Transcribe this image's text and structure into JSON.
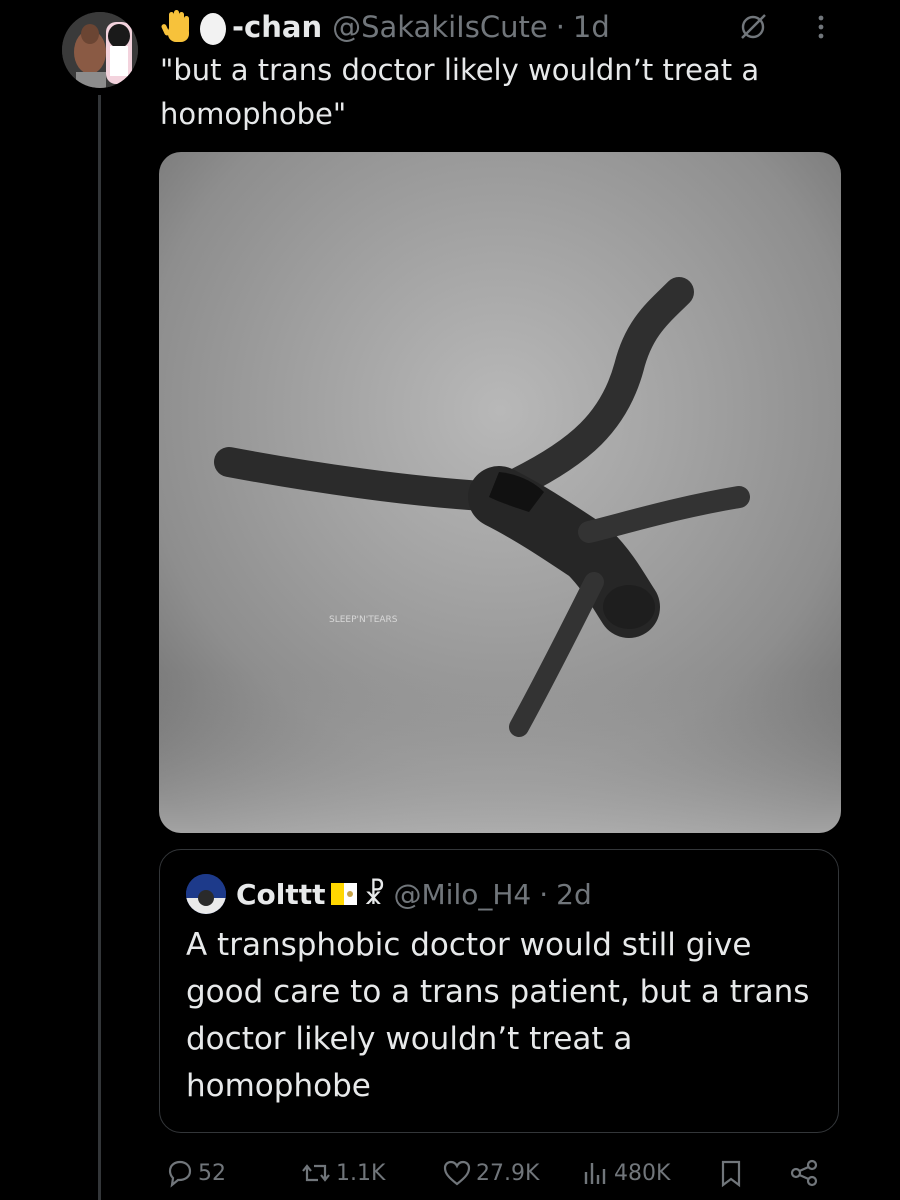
{
  "tweet": {
    "display_name": "-chan",
    "handle": "@SakakiIsCute",
    "separator": "·",
    "time": "1d",
    "text": "\"but a trans doctor likely wouldn’t treat a homophobe\"",
    "media": {
      "watermark": "SLEEP'N'TEARS"
    }
  },
  "quote": {
    "display_name": "Colttt",
    "chi_rho": "☧",
    "handle": "@Milo_H4",
    "separator": "·",
    "time": "2d",
    "text": "A transphobic doctor would still give good care to a trans patient, but a trans doctor likely wouldn’t treat a homophobe"
  },
  "actions": {
    "replies": "52",
    "reposts": "1.1K",
    "likes": "27.9K",
    "views": "480K"
  },
  "colors": {
    "background": "#000000",
    "text": "#e7e9ea",
    "muted": "#71767b",
    "border": "#333639"
  },
  "icons": [
    "raised-hand-emoji",
    "egg-emoji",
    "grok-icon",
    "more-icon",
    "vatican-flag",
    "reply-icon",
    "repost-icon",
    "like-icon",
    "views-icon",
    "bookmark-icon",
    "share-icon"
  ]
}
